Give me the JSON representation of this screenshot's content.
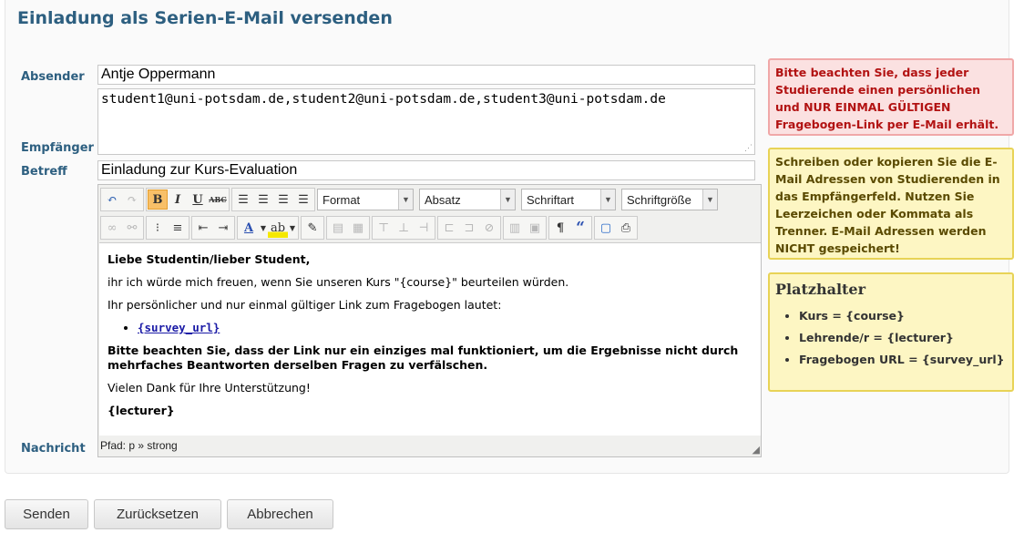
{
  "page_title": "Einladung als Serien-E-Mail versenden",
  "labels": {
    "sender": "Absender",
    "recipients": "Empfänger",
    "subject": "Betreff",
    "message": "Nachricht"
  },
  "sender_value": "Antje Oppermann",
  "recipients_value": "student1@uni-potsdam.de,student2@uni-potsdam.de,student3@uni-potsdam.de",
  "subject_value": "Einladung zur Kurs-Evaluation",
  "editor": {
    "selects": {
      "format": "Format",
      "absatz": "Absatz",
      "schriftart": "Schriftart",
      "schriftgroesse": "Schriftgröße"
    },
    "buttons": {
      "bold": "B",
      "italic": "I",
      "underline": "U",
      "strike": "ABC",
      "pilcrow": "¶",
      "quote": "“"
    },
    "content": {
      "greeting": "Liebe Studentin/lieber Student,",
      "line1": "ihr ich würde mich freuen, wenn Sie unseren Kurs \"{course}\" beurteilen würden.",
      "line2": "Ihr persönlicher und nur einmal gültiger Link zum Fragebogen lautet:",
      "link": "{survey_url}",
      "warning": "Bitte beachten Sie, dass der Link nur ein einziges mal funktioniert, um die Ergebnisse nicht durch mehrfaches Beantworten derselben Fragen zu verfälschen.",
      "thanks": "Vielen Dank für Ihre Unterstützung!",
      "signature": "{lecturer}"
    },
    "path": "Pfad: p » strong"
  },
  "notes": {
    "red": "Bitte beachten Sie, dass jeder Studierende einen persönlichen und NUR EINMAL GÜLTIGEN Fragebogen-Link per E-Mail erhält.",
    "yellow": "Schreiben oder kopieren Sie die E-Mail Adressen von Studierenden in das Empfängerfeld. Nutzen Sie Leerzeichen oder Kommata als Trenner. E-Mail Adressen werden NICHT gespeichert!",
    "placeholder_title": "Platzhalter",
    "placeholders": [
      "Kurs = {course}",
      "Lehrende/r = {lecturer}",
      "Fragebogen URL = {survey_url}"
    ]
  },
  "footer_buttons": {
    "send": "Senden",
    "reset": "Zurücksetzen",
    "cancel": "Abbrechen"
  },
  "colors": {
    "heading": "#2d5f80",
    "alert_bg": "#fbe1e1",
    "alert_text": "#b21212",
    "note_bg": "#fdf6c3"
  }
}
